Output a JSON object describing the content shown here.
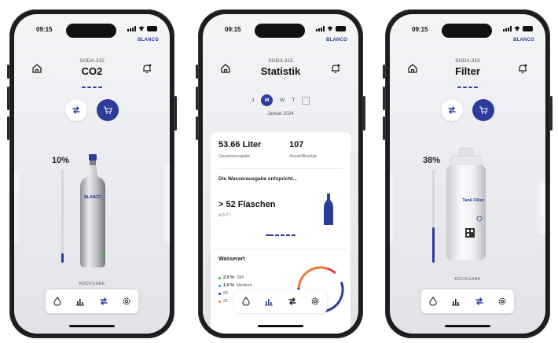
{
  "colors": {
    "accent": "#2d3b9a",
    "green": "#3cb054",
    "blue": "#3a8fd6",
    "orange": "#f07a3a"
  },
  "phones": [
    {
      "status_time": "09:15",
      "brand": "BLANCO",
      "model": "SODA-315",
      "title": "CO2",
      "level_percent": "10%",
      "level_fraction": 0.1,
      "caption": "RÜCKGABE",
      "illustration": "co2-bottle",
      "bottle_label": "BLANCO"
    },
    {
      "status_time": "09:15",
      "brand": "BLANCO",
      "model": "SODA-315",
      "title": "Statistik",
      "calendar": {
        "days": [
          "J",
          "M",
          "W",
          "T"
        ],
        "selected": "M",
        "month": "Januar 2024"
      },
      "total_value": "53.66 Liter",
      "total_label": "Gesamtausgabe",
      "count_value": "107",
      "count_label": "AnzahlBezüge",
      "water_heading": "Die Wasserausgabe entspricht...",
      "bottles_value": "> 52 Flaschen",
      "bottles_sub": "à 0.7 l",
      "water_type_title": "Wasserart",
      "water_types": [
        {
          "value": "2.0 %",
          "label": "Still",
          "color": "#3cb054"
        },
        {
          "value": "1.0 %",
          "label": "Medium",
          "color": "#3a8fd6"
        },
        {
          "value": "65",
          "label": "",
          "color": "#2d3b9a"
        },
        {
          "value": "31",
          "label": "",
          "color": "#f07a3a"
        }
      ]
    },
    {
      "status_time": "09:15",
      "brand": "BLANCO",
      "model": "SODA-315",
      "title": "Filter",
      "level_percent": "38%",
      "level_fraction": 0.38,
      "caption": "RÜCKGABE",
      "illustration": "water-filter",
      "filter_label": "Tank Filter"
    }
  ],
  "nav_icons": [
    "drop-icon",
    "chart-icon",
    "swap-icon",
    "gear-icon"
  ],
  "action_icons": [
    "swap-icon",
    "cart-icon"
  ],
  "header_icons": [
    "home-icon",
    "bell-icon"
  ]
}
